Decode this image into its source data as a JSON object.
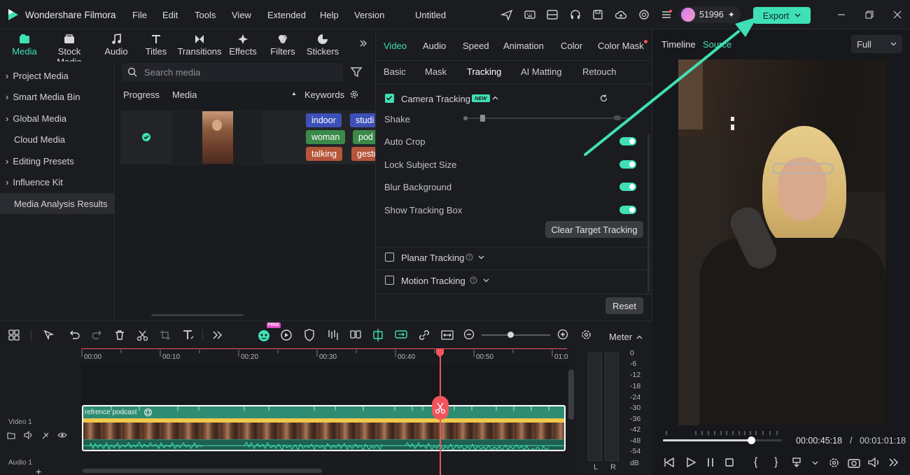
{
  "app": {
    "name": "Wondershare Filmora",
    "menu": [
      "File",
      "Edit",
      "Tools",
      "View",
      "Extended",
      "Help",
      "Version"
    ],
    "project_title": "Untitled",
    "credits": "51996",
    "export_label": "Export"
  },
  "media_tabs": [
    {
      "label": "Media",
      "icon": "media-icon"
    },
    {
      "label": "Stock Media",
      "icon": "stock-media-icon"
    },
    {
      "label": "Audio",
      "icon": "music-note-icon"
    },
    {
      "label": "Titles",
      "icon": "title-t-icon"
    },
    {
      "label": "Transitions",
      "icon": "transition-icon"
    },
    {
      "label": "Effects",
      "icon": "effects-icon"
    },
    {
      "label": "Filters",
      "icon": "filters-icon"
    },
    {
      "label": "Stickers",
      "icon": "stickers-icon"
    }
  ],
  "sidebar": {
    "items": [
      "Project Media",
      "Smart Media Bin",
      "Global Media",
      "Cloud Media",
      "Editing Presets",
      "Influence Kit",
      "Media Analysis Results"
    ]
  },
  "media_area": {
    "search_placeholder": "Search media",
    "col_progress": "Progress",
    "col_media": "Media",
    "col_keywords": "Keywords",
    "tags": [
      {
        "label": "indoor",
        "color": "#3d4fb8"
      },
      {
        "label": "studi",
        "color": "#3d4fb8"
      },
      {
        "label": "woman",
        "color": "#3b8a4a"
      },
      {
        "label": "pod",
        "color": "#3b8a4a"
      },
      {
        "label": "talking",
        "color": "#b5553a"
      },
      {
        "label": "gestu",
        "color": "#b5553a"
      }
    ]
  },
  "props": {
    "tabs": [
      "Video",
      "Audio",
      "Speed",
      "Animation",
      "Color",
      "Color Mask"
    ],
    "subtabs": [
      "Basic",
      "Mask",
      "Tracking",
      "AI Matting",
      "Retouch"
    ],
    "camera_tracking": "Camera Tracking",
    "new_badge": "NEW",
    "shake": "Shake",
    "auto_crop": "Auto Crop",
    "lock_subject": "Lock Subject Size",
    "blur_bg": "Blur Background",
    "show_box": "Show Tracking Box",
    "clear_btn": "Clear Target Tracking",
    "planar": "Planar Tracking",
    "motion": "Motion Tracking",
    "reset": "Reset"
  },
  "player": {
    "tab_timeline": "Timeline",
    "tab_source": "Source",
    "quality": "Full",
    "current_time": "00:00:45:18",
    "separator": "/",
    "total_time": "00:01:01:18",
    "progress": 0.74
  },
  "timeline": {
    "ticks": [
      "00:00",
      "00:10",
      "00:20",
      "00:30",
      "00:40",
      "00:50",
      "01:0"
    ],
    "clip_name": "refrence podcast",
    "track_video": "Video 1",
    "track_audio": "Audio 1",
    "free_badge": "FREE",
    "meter_label": "Meter",
    "meter_scale": [
      "0",
      "-6",
      "-12",
      "-18",
      "-24",
      "-30",
      "-36",
      "-42",
      "-48",
      "-54",
      "dB"
    ],
    "meter_l": "L",
    "meter_r": "R"
  },
  "colors": {
    "accent": "#3fe0b5",
    "playhead": "#f2545b",
    "clip": "#2e8c72"
  }
}
